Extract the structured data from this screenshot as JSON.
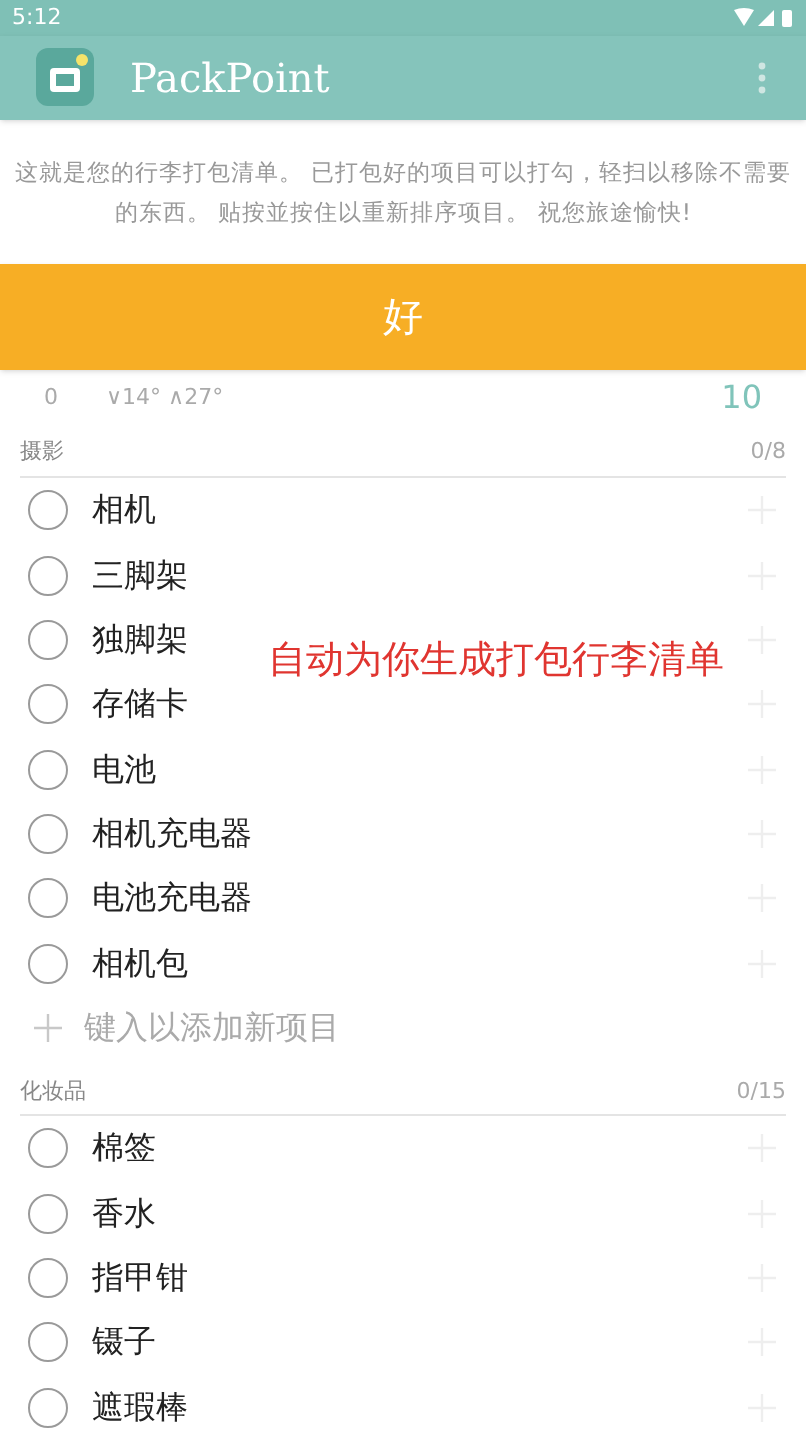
{
  "status_bar": {
    "time": "5:12"
  },
  "app_bar": {
    "title": "PackPoint"
  },
  "intro": {
    "text": "这就是您的行李打包清单。 已打包好的项目可以打勾，轻扫以移除不需要的东西。 贴按並按住以重新排序项目。 祝您旅途愉快!"
  },
  "ok_button": {
    "label": "好"
  },
  "weather": {
    "column_1": "0",
    "temps": "∨14° ∧27°",
    "column_3": "10"
  },
  "sections": [
    {
      "title": "摄影",
      "count": "0/8",
      "add_placeholder": "键入以添加新项目",
      "items": [
        {
          "label": "相机",
          "checked": false
        },
        {
          "label": "三脚架",
          "checked": false
        },
        {
          "label": "独脚架",
          "checked": false
        },
        {
          "label": "存储卡",
          "checked": false
        },
        {
          "label": "电池",
          "checked": false
        },
        {
          "label": "相机充电器",
          "checked": false
        },
        {
          "label": "电池充电器",
          "checked": false
        },
        {
          "label": "相机包",
          "checked": false
        }
      ]
    },
    {
      "title": "化妆品",
      "count": "0/15",
      "items": [
        {
          "label": "棉签",
          "checked": false
        },
        {
          "label": "香水",
          "checked": false
        },
        {
          "label": "指甲钳",
          "checked": false
        },
        {
          "label": "镊子",
          "checked": false
        },
        {
          "label": "遮瑕棒",
          "checked": false
        }
      ]
    }
  ],
  "caption": {
    "text": "自动为你生成打包行李清单"
  }
}
